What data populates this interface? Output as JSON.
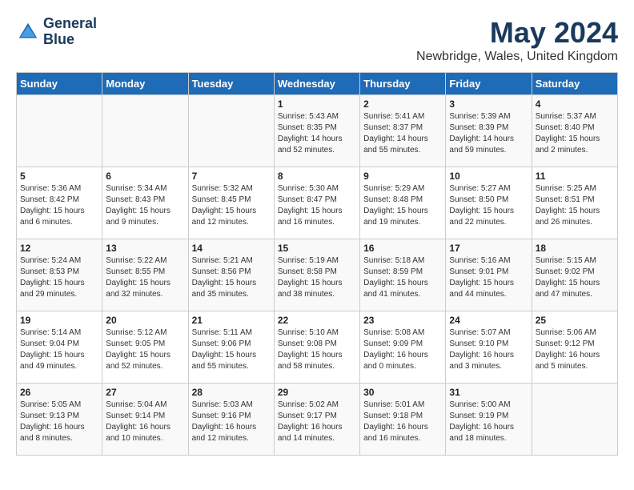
{
  "logo": {
    "text_line1": "General",
    "text_line2": "Blue"
  },
  "title": "May 2024",
  "location": "Newbridge, Wales, United Kingdom",
  "days_of_week": [
    "Sunday",
    "Monday",
    "Tuesday",
    "Wednesday",
    "Thursday",
    "Friday",
    "Saturday"
  ],
  "weeks": [
    [
      {
        "day": "",
        "info": ""
      },
      {
        "day": "",
        "info": ""
      },
      {
        "day": "",
        "info": ""
      },
      {
        "day": "1",
        "info": "Sunrise: 5:43 AM\nSunset: 8:35 PM\nDaylight: 14 hours and 52 minutes."
      },
      {
        "day": "2",
        "info": "Sunrise: 5:41 AM\nSunset: 8:37 PM\nDaylight: 14 hours and 55 minutes."
      },
      {
        "day": "3",
        "info": "Sunrise: 5:39 AM\nSunset: 8:39 PM\nDaylight: 14 hours and 59 minutes."
      },
      {
        "day": "4",
        "info": "Sunrise: 5:37 AM\nSunset: 8:40 PM\nDaylight: 15 hours and 2 minutes."
      }
    ],
    [
      {
        "day": "5",
        "info": "Sunrise: 5:36 AM\nSunset: 8:42 PM\nDaylight: 15 hours and 6 minutes."
      },
      {
        "day": "6",
        "info": "Sunrise: 5:34 AM\nSunset: 8:43 PM\nDaylight: 15 hours and 9 minutes."
      },
      {
        "day": "7",
        "info": "Sunrise: 5:32 AM\nSunset: 8:45 PM\nDaylight: 15 hours and 12 minutes."
      },
      {
        "day": "8",
        "info": "Sunrise: 5:30 AM\nSunset: 8:47 PM\nDaylight: 15 hours and 16 minutes."
      },
      {
        "day": "9",
        "info": "Sunrise: 5:29 AM\nSunset: 8:48 PM\nDaylight: 15 hours and 19 minutes."
      },
      {
        "day": "10",
        "info": "Sunrise: 5:27 AM\nSunset: 8:50 PM\nDaylight: 15 hours and 22 minutes."
      },
      {
        "day": "11",
        "info": "Sunrise: 5:25 AM\nSunset: 8:51 PM\nDaylight: 15 hours and 26 minutes."
      }
    ],
    [
      {
        "day": "12",
        "info": "Sunrise: 5:24 AM\nSunset: 8:53 PM\nDaylight: 15 hours and 29 minutes."
      },
      {
        "day": "13",
        "info": "Sunrise: 5:22 AM\nSunset: 8:55 PM\nDaylight: 15 hours and 32 minutes."
      },
      {
        "day": "14",
        "info": "Sunrise: 5:21 AM\nSunset: 8:56 PM\nDaylight: 15 hours and 35 minutes."
      },
      {
        "day": "15",
        "info": "Sunrise: 5:19 AM\nSunset: 8:58 PM\nDaylight: 15 hours and 38 minutes."
      },
      {
        "day": "16",
        "info": "Sunrise: 5:18 AM\nSunset: 8:59 PM\nDaylight: 15 hours and 41 minutes."
      },
      {
        "day": "17",
        "info": "Sunrise: 5:16 AM\nSunset: 9:01 PM\nDaylight: 15 hours and 44 minutes."
      },
      {
        "day": "18",
        "info": "Sunrise: 5:15 AM\nSunset: 9:02 PM\nDaylight: 15 hours and 47 minutes."
      }
    ],
    [
      {
        "day": "19",
        "info": "Sunrise: 5:14 AM\nSunset: 9:04 PM\nDaylight: 15 hours and 49 minutes."
      },
      {
        "day": "20",
        "info": "Sunrise: 5:12 AM\nSunset: 9:05 PM\nDaylight: 15 hours and 52 minutes."
      },
      {
        "day": "21",
        "info": "Sunrise: 5:11 AM\nSunset: 9:06 PM\nDaylight: 15 hours and 55 minutes."
      },
      {
        "day": "22",
        "info": "Sunrise: 5:10 AM\nSunset: 9:08 PM\nDaylight: 15 hours and 58 minutes."
      },
      {
        "day": "23",
        "info": "Sunrise: 5:08 AM\nSunset: 9:09 PM\nDaylight: 16 hours and 0 minutes."
      },
      {
        "day": "24",
        "info": "Sunrise: 5:07 AM\nSunset: 9:10 PM\nDaylight: 16 hours and 3 minutes."
      },
      {
        "day": "25",
        "info": "Sunrise: 5:06 AM\nSunset: 9:12 PM\nDaylight: 16 hours and 5 minutes."
      }
    ],
    [
      {
        "day": "26",
        "info": "Sunrise: 5:05 AM\nSunset: 9:13 PM\nDaylight: 16 hours and 8 minutes."
      },
      {
        "day": "27",
        "info": "Sunrise: 5:04 AM\nSunset: 9:14 PM\nDaylight: 16 hours and 10 minutes."
      },
      {
        "day": "28",
        "info": "Sunrise: 5:03 AM\nSunset: 9:16 PM\nDaylight: 16 hours and 12 minutes."
      },
      {
        "day": "29",
        "info": "Sunrise: 5:02 AM\nSunset: 9:17 PM\nDaylight: 16 hours and 14 minutes."
      },
      {
        "day": "30",
        "info": "Sunrise: 5:01 AM\nSunset: 9:18 PM\nDaylight: 16 hours and 16 minutes."
      },
      {
        "day": "31",
        "info": "Sunrise: 5:00 AM\nSunset: 9:19 PM\nDaylight: 16 hours and 18 minutes."
      },
      {
        "day": "",
        "info": ""
      }
    ]
  ]
}
